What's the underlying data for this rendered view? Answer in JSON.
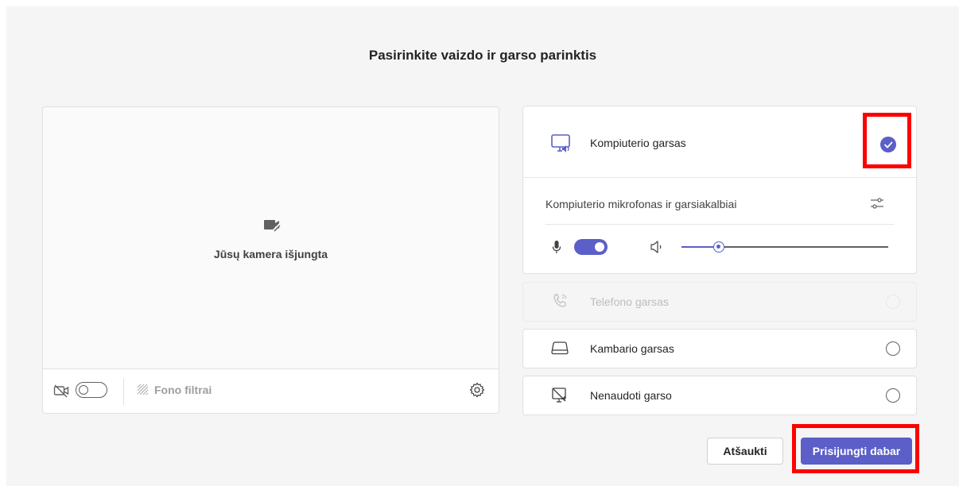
{
  "dialog": {
    "title": "Pasirinkite vaizdo ir garso parinktis"
  },
  "camera": {
    "off_text": "Jūsų kamera išjungta",
    "background_filters_label": "Fono filtrai",
    "camera_toggle_on": false,
    "icons": [
      "camera-off-icon",
      "background-filter-icon",
      "settings-icon"
    ]
  },
  "audio_options": {
    "computer": {
      "label": "Kompiuterio garsas",
      "selected": true,
      "mic_speaker_label": "Kompiuterio mikrofonas ir garsiakalbiai",
      "mic_on": true,
      "speaker_volume": 0.18
    },
    "phone": {
      "label": "Telefono garsas",
      "disabled": true
    },
    "room": {
      "label": "Kambario garsas",
      "selected": false
    },
    "none": {
      "label": "Nenaudoti garso",
      "selected": false
    }
  },
  "buttons": {
    "cancel": "Atšaukti",
    "join": "Prisijungti dabar"
  },
  "colors": {
    "accent": "#5b5fc7",
    "highlight": "#ff0000",
    "background": "#f5f5f5"
  }
}
